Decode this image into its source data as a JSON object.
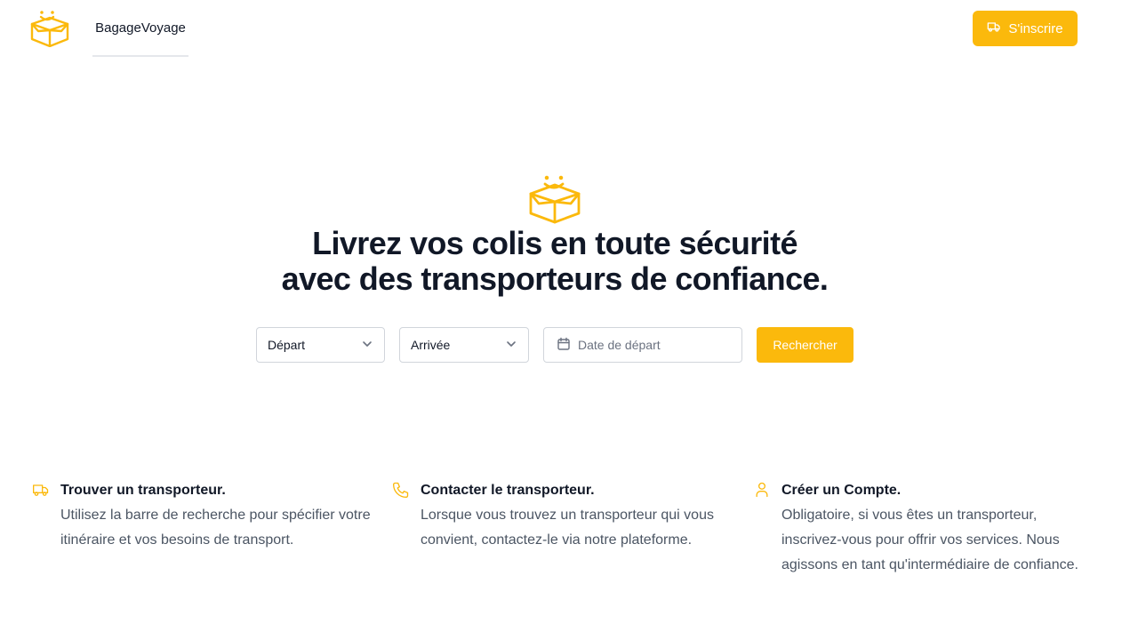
{
  "header": {
    "brand": "BagageVoyage",
    "signup_label": "S'inscrire",
    "logo_icon": "smiling-box-icon",
    "signup_icon": "truck-icon"
  },
  "hero": {
    "title_line1": "Livrez vos colis en toute sécurité",
    "title_line2": "avec des transporteurs de confiance.",
    "icon": "smiling-box-icon"
  },
  "search": {
    "depart_label": "Départ",
    "arrivee_label": "Arrivée",
    "date_placeholder": "Date de départ",
    "button_label": "Rechercher"
  },
  "features": [
    {
      "icon": "truck-icon",
      "title": "Trouver un transporteur.",
      "text": "Utilisez la barre de recherche pour spécifier votre itinéraire et vos besoins de transport."
    },
    {
      "icon": "phone-icon",
      "title": "Contacter le transporteur.",
      "text": "Lorsque vous trouvez un transporteur qui vous convient, contactez-le via notre plateforme."
    },
    {
      "icon": "user-icon",
      "title": "Créer un Compte.",
      "text": "Obligatoire, si vous êtes un transporteur, inscrivez-vous pour offrir vos services. Nous agissons en tant qu'intermédiaire de confiance."
    }
  ],
  "colors": {
    "accent": "#fbb90c",
    "text": "#111827",
    "muted": "#4b5563",
    "border": "#d1d5db"
  }
}
